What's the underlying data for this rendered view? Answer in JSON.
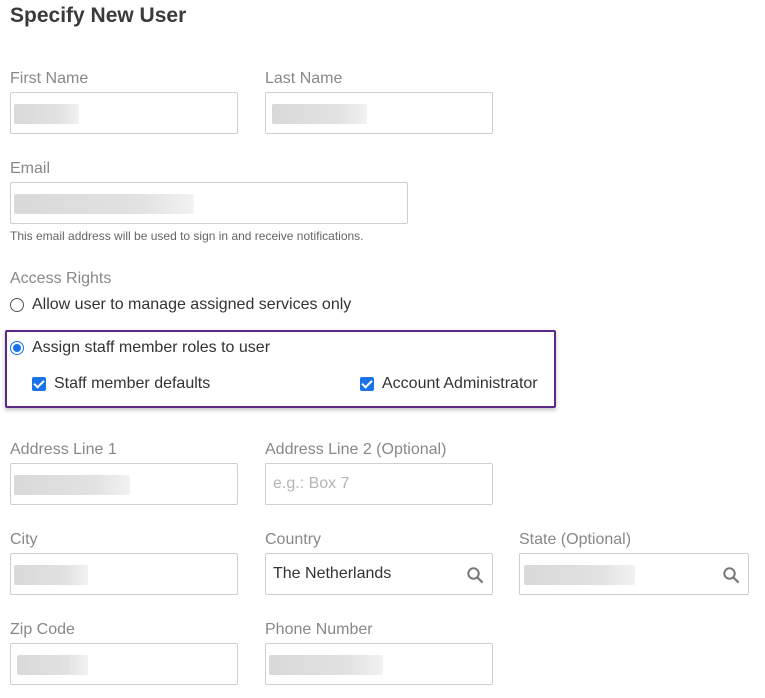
{
  "page": {
    "title": "Specify New User"
  },
  "fields": {
    "first_name": {
      "label": "First Name"
    },
    "last_name": {
      "label": "Last Name"
    },
    "email": {
      "label": "Email",
      "help": "This email address will be used to sign in and receive notifications."
    },
    "address1": {
      "label": "Address Line 1"
    },
    "address2": {
      "label": "Address Line 2 (Optional)",
      "placeholder": "e.g.: Box 7"
    },
    "city": {
      "label": "City"
    },
    "country": {
      "label": "Country",
      "value": "The Netherlands"
    },
    "state": {
      "label": "State (Optional)"
    },
    "zip": {
      "label": "Zip Code"
    },
    "phone": {
      "label": "Phone Number"
    }
  },
  "access_rights": {
    "label": "Access Rights",
    "options": [
      {
        "label": "Allow user to manage assigned services only",
        "selected": false
      },
      {
        "label": "Assign staff member roles to user",
        "selected": true
      }
    ],
    "roles": [
      {
        "label": "Staff member defaults",
        "checked": true
      },
      {
        "label": "Account Administrator",
        "checked": true
      }
    ]
  },
  "colors": {
    "accent": "#1a73e8",
    "highlight_border": "#5b2a86"
  },
  "icons": {
    "search": "search-icon"
  }
}
